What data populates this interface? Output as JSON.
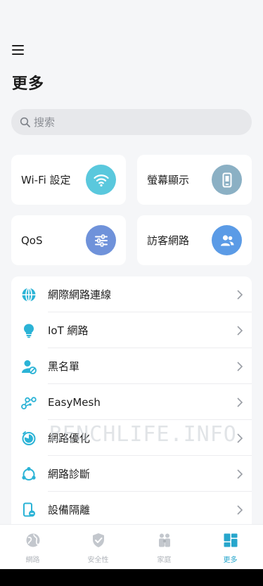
{
  "header": {
    "title": "更多",
    "menu_icon": "hamburger-menu-icon"
  },
  "search": {
    "placeholder": "搜索",
    "icon": "search-icon"
  },
  "cards": [
    {
      "label": "Wi-Fi 設定",
      "icon": "wifi-icon",
      "color": "#5ac8dd"
    },
    {
      "label": "螢幕顯示",
      "icon": "phone-screen-icon",
      "color": "#8bb0c4"
    },
    {
      "label": "QoS",
      "icon": "sliders-icon",
      "color": "#6f92da"
    },
    {
      "label": "訪客網路",
      "icon": "guests-icon",
      "color": "#5b9be6"
    }
  ],
  "list": [
    {
      "label": "網際網路連線",
      "icon": "globe-icon"
    },
    {
      "label": "IoT 網路",
      "icon": "lightbulb-icon"
    },
    {
      "label": "黑名單",
      "icon": "blocked-user-icon"
    },
    {
      "label": "EasyMesh",
      "icon": "mesh-network-icon"
    },
    {
      "label": "網路優化",
      "icon": "optimize-icon"
    },
    {
      "label": "網路診斷",
      "icon": "diagnosis-icon"
    },
    {
      "label": "設備隔離",
      "icon": "device-isolation-icon"
    }
  ],
  "watermark": "BENCHLIFE.INFO",
  "tabs": [
    {
      "label": "網路",
      "icon": "network-tab-icon",
      "active": false
    },
    {
      "label": "安全性",
      "icon": "shield-tab-icon",
      "active": false
    },
    {
      "label": "家庭",
      "icon": "family-tab-icon",
      "active": false
    },
    {
      "label": "更多",
      "icon": "more-tab-icon",
      "active": true
    }
  ],
  "colors": {
    "accent": "#27a6cc",
    "inactive": "#b0b4ba",
    "list_icon": "#2bb3d6"
  }
}
